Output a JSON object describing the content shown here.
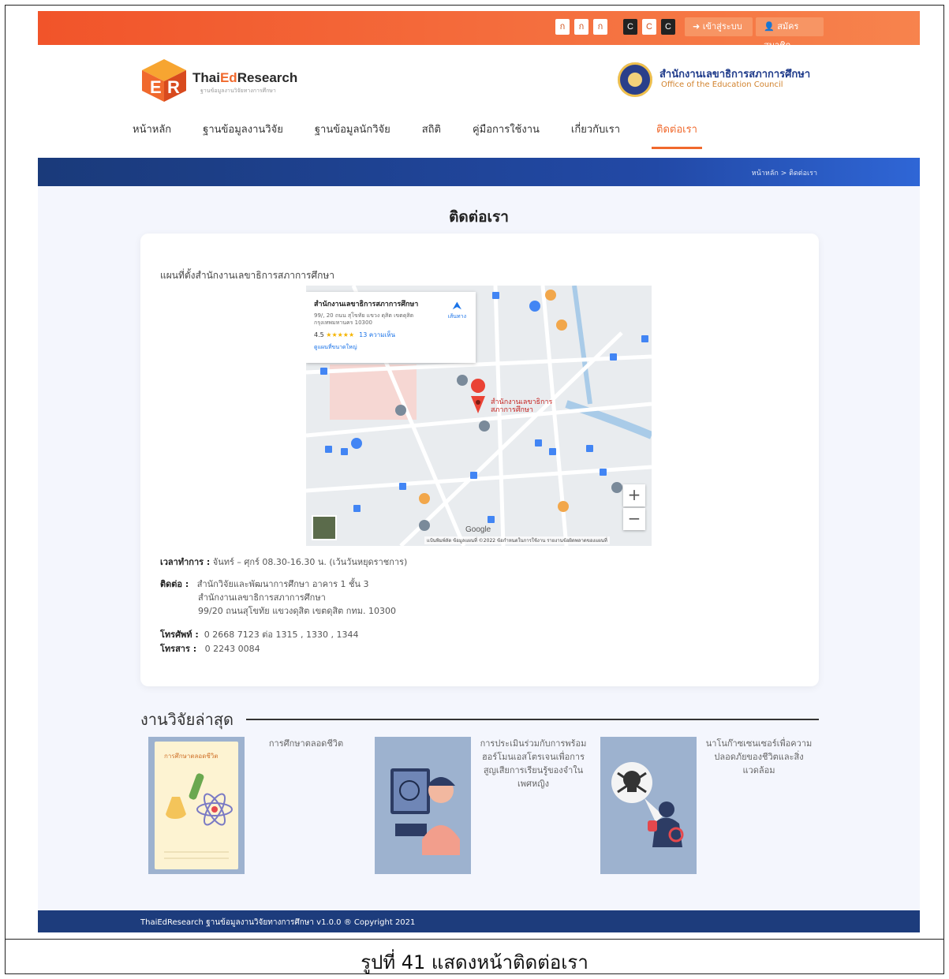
{
  "topbar": {
    "font_buttons": [
      "ก",
      "ก",
      "ก"
    ],
    "contrast_buttons": [
      "C",
      "C",
      "C"
    ],
    "login_label": "เข้าสู่ระบบ",
    "register_label": "สมัครสมาชิก",
    "accent_color": "#f1542a"
  },
  "header": {
    "logo_text_1": "Thai",
    "logo_text_ed": "Ed",
    "logo_text_2": "Research",
    "logo_sub": "ฐานข้อมูลงานวิจัยทางการศึกษา",
    "org_th": "สำนักงานเลขาธิการสภาการศึกษา",
    "org_en": "Office of the Education Council"
  },
  "nav": {
    "items": [
      "หน้าหลัก",
      "ฐานข้อมูลงานวิจัย",
      "ฐานข้อมูลนักวิจัย",
      "สถิติ",
      "คู่มือการใช้งาน",
      "เกี่ยวกับเรา",
      "ติดต่อเรา"
    ],
    "active": "ติดต่อเรา"
  },
  "breadcrumb": "หน้าหลัก > ติดต่อเรา",
  "page_title": "ติดต่อเรา",
  "contact": {
    "map_title": "แผนที่ตั้งสำนักงานเลขาธิการสภาการศึกษา",
    "map_info_title": "สำนักงานเลขาธิการสภาการศึกษา",
    "map_info_addr": "99/, 20 ถนน สุโขทัย แขวง ดุสิต เขตดุสิต กรุงเทพมหานคร 10300",
    "map_rating": "4.5",
    "map_stars": "★★★★★",
    "map_reviews": "13 ความเห็น",
    "map_larger": "ดูแผนที่ขนาดใหญ่",
    "map_directions": "เส้นทาง",
    "map_footer": "แป้นพิมพ์ลัด   ข้อมูลแผนที่ ©2022   ข้อกำหนดในการใช้งาน   รายงานข้อผิดพลาดของแผนที่",
    "hours_label": "เวลาทำการ :",
    "hours_value": "จันทร์ – ศุกร์ 08.30-16.30 น. (เว้นวันหยุดราชการ)",
    "contact_label": "ติดต่อ :",
    "contact_line1": "สำนักวิจัยและพัฒนาการศึกษา อาคาร 1 ชั้น 3",
    "contact_line2": "สำนักงานเลขาธิการสภาการศึกษา",
    "contact_line3": "99/20 ถนนสุโขทัย แขวงดุสิต เขตดุสิต กทม. 10300",
    "phone_label": "โทรศัพท์ :",
    "phone_value": "0 2668 7123 ต่อ 1315 , 1330 , 1344",
    "fax_label": "โทรสาร :",
    "fax_value": "0 2243 0084"
  },
  "research": {
    "title": "งานวิจัยล่าสุด",
    "cover1_title": "การศึกษาตลอดชีวิต",
    "items": [
      "การศึกษาตลอดชีวิต",
      "การประเมินร่วมกับการพร้อมฮอร์โมนเอสโตรเจนเพื่อการสูญเสียการเรียนรู้ของจำในเพศหญิง",
      "นาโนก๊าซเซนเซอร์เพื่อความปลอดภัยของชีวิตและสิ่งแวดล้อม"
    ]
  },
  "footer": "ThaiEdResearch ฐานข้อมูลงานวิจัยทางการศึกษา v1.0.0 ® Copyright 2021",
  "caption": "รูปที่ 41 แสดงหน้าติดต่อเรา"
}
